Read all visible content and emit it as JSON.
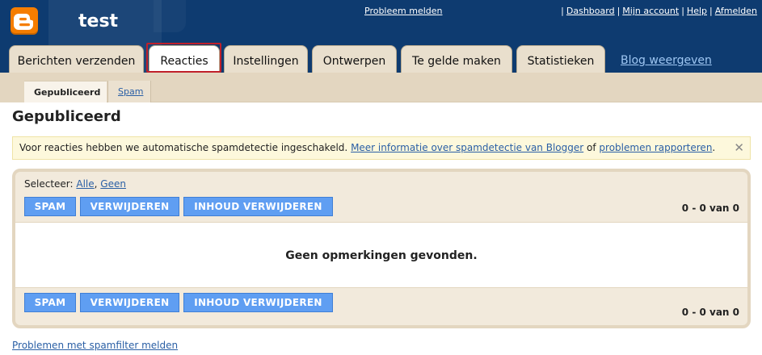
{
  "header": {
    "blog_title": "test",
    "problem_link": "Probleem melden",
    "top_links": [
      "Dashboard",
      "Mijn account",
      "Help",
      "Afmelden"
    ]
  },
  "tabs": [
    {
      "label": "Berichten verzenden",
      "active": false
    },
    {
      "label": "Reacties",
      "active": true
    },
    {
      "label": "Instellingen",
      "active": false
    },
    {
      "label": "Ontwerpen",
      "active": false
    },
    {
      "label": "Te gelde maken",
      "active": false
    },
    {
      "label": "Statistieken",
      "active": false
    }
  ],
  "view_blog": "Blog weergeven",
  "subtabs": {
    "published": "Gepubliceerd",
    "spam": "Spam"
  },
  "page_title": "Gepubliceerd",
  "notice": {
    "text_before": "Voor reacties hebben we automatische spamdetectie ingeschakeld.",
    "link1": "Meer informatie over spamdetectie van Blogger",
    "text_middle": "of",
    "link2": "problemen rapporteren",
    "text_after": ".",
    "close": "✕"
  },
  "comments": {
    "select_label": "Selecteer:",
    "select_all": "Alle",
    "select_none": "Geen",
    "buttons": {
      "spam": "SPAM",
      "delete": "VERWIJDEREN",
      "delete_content": "INHOUD VERWIJDEREN"
    },
    "count_top": "0 - 0 van 0",
    "count_bottom": "0 - 0 van 0",
    "empty": "Geen opmerkingen gevonden."
  },
  "footer_link": "Problemen met spamfilter melden",
  "colors": {
    "header": "#0e3b70",
    "accent": "#f57d00",
    "button": "#5f9ef2",
    "tab": "#e9dfcd"
  },
  "icons": {
    "logo": "blogger-logo-icon",
    "close": "close-icon"
  }
}
